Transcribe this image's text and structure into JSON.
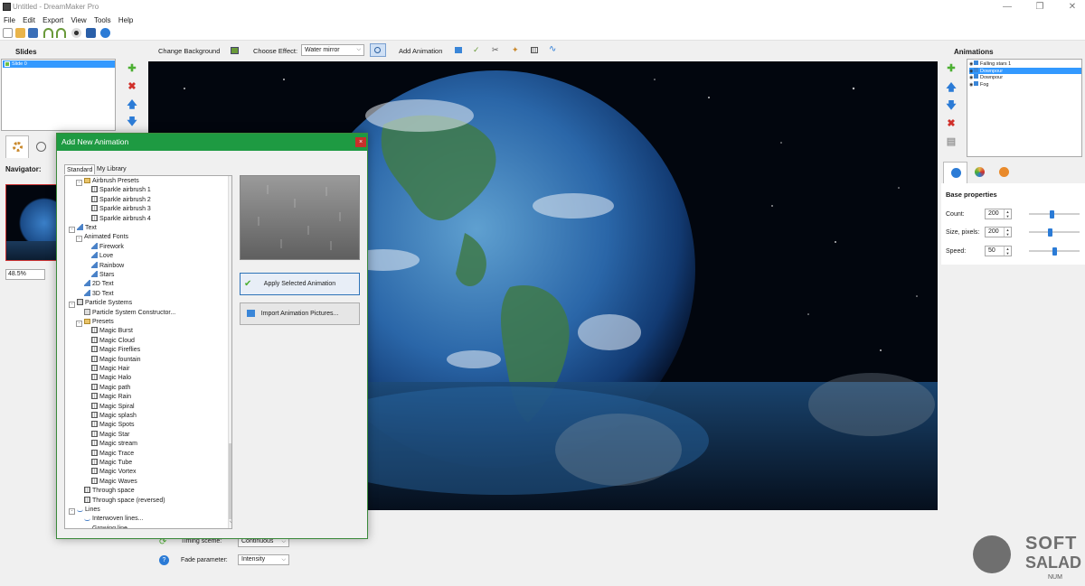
{
  "window": {
    "title": "Untitled - DreamMaker Pro",
    "controls": {
      "minimize": "—",
      "restore": "❐",
      "close": "✕"
    }
  },
  "menu": [
    "File",
    "Edit",
    "Export",
    "View",
    "Tools",
    "Help"
  ],
  "toolbar_icons": [
    "new-icon",
    "open-folder-icon",
    "save-icon",
    "magnet-icon",
    "magnet-icon",
    "eye-icon",
    "film-icon",
    "info-icon"
  ],
  "slides": {
    "title": "Slides",
    "items": [
      "Slide 0"
    ]
  },
  "navigator": {
    "label": "Navigator:",
    "zoom": "48.5%"
  },
  "main_toolbar": {
    "change_background": "Change Background",
    "choose_effect_label": "Choose Effect:",
    "effect_value": "Water mirror",
    "add_animation": "Add Animation"
  },
  "dialog": {
    "title": "Add New Animation",
    "close": "×",
    "tabs": [
      "Standard",
      "My Library"
    ],
    "tree": [
      {
        "label": "Airbrush Presets",
        "level": 1,
        "icon": "folder",
        "toggle": "-"
      },
      {
        "label": "Sparkle airbrush 1",
        "level": 2,
        "icon": "grid"
      },
      {
        "label": "Sparkle airbrush 2",
        "level": 2,
        "icon": "grid"
      },
      {
        "label": "Sparkle airbrush 3",
        "level": 2,
        "icon": "grid"
      },
      {
        "label": "Sparkle airbrush 4",
        "level": 2,
        "icon": "grid"
      },
      {
        "label": "Text",
        "level": 0,
        "icon": "text",
        "toggle": "-"
      },
      {
        "label": "Animated Fonts",
        "level": 1,
        "icon": "none",
        "toggle": "-"
      },
      {
        "label": "Firework",
        "level": 2,
        "icon": "text"
      },
      {
        "label": "Love",
        "level": 2,
        "icon": "text"
      },
      {
        "label": "Rainbow",
        "level": 2,
        "icon": "text"
      },
      {
        "label": "Stars",
        "level": 2,
        "icon": "text"
      },
      {
        "label": "2D Text",
        "level": 1,
        "icon": "text"
      },
      {
        "label": "3D Text",
        "level": 1,
        "icon": "text"
      },
      {
        "label": "Particle Systems",
        "level": 0,
        "icon": "grid",
        "toggle": "-"
      },
      {
        "label": "Particle System Constructor...",
        "level": 1,
        "icon": "box"
      },
      {
        "label": "Presets",
        "level": 1,
        "icon": "folder",
        "toggle": "-"
      },
      {
        "label": "Magic Burst",
        "level": 2,
        "icon": "grid"
      },
      {
        "label": "Magic Cloud",
        "level": 2,
        "icon": "grid"
      },
      {
        "label": "Magic Fireflies",
        "level": 2,
        "icon": "grid"
      },
      {
        "label": "Magic fountain",
        "level": 2,
        "icon": "grid"
      },
      {
        "label": "Magic Hair",
        "level": 2,
        "icon": "grid"
      },
      {
        "label": "Magic Halo",
        "level": 2,
        "icon": "grid"
      },
      {
        "label": "Magic path",
        "level": 2,
        "icon": "grid"
      },
      {
        "label": "Magic Rain",
        "level": 2,
        "icon": "grid"
      },
      {
        "label": "Magic Spiral",
        "level": 2,
        "icon": "grid"
      },
      {
        "label": "Magic splash",
        "level": 2,
        "icon": "grid"
      },
      {
        "label": "Magic Spots",
        "level": 2,
        "icon": "grid"
      },
      {
        "label": "Magic Star",
        "level": 2,
        "icon": "grid"
      },
      {
        "label": "Magic stream",
        "level": 2,
        "icon": "grid"
      },
      {
        "label": "Magic Trace",
        "level": 2,
        "icon": "grid"
      },
      {
        "label": "Magic Tube",
        "level": 2,
        "icon": "grid"
      },
      {
        "label": "Magic Vortex",
        "level": 2,
        "icon": "grid"
      },
      {
        "label": "Magic Waves",
        "level": 2,
        "icon": "grid"
      },
      {
        "label": "Through space",
        "level": 1,
        "icon": "grid"
      },
      {
        "label": "Through space (reversed)",
        "level": 1,
        "icon": "grid"
      },
      {
        "label": "Lines",
        "level": 0,
        "icon": "wave",
        "toggle": "-"
      },
      {
        "label": "Interwoven lines...",
        "level": 1,
        "icon": "wave"
      },
      {
        "label": "Growing line...",
        "level": 1,
        "icon": "wave"
      }
    ],
    "apply_button": "Apply Selected Animation",
    "import_button": "Import Animation Pictures..."
  },
  "timing": {
    "timing_label": "Timing sceme:",
    "timing_value": "Continuous",
    "fade_label": "Fade parameter:",
    "fade_value": "Intensity"
  },
  "animations": {
    "title": "Animations",
    "items": [
      {
        "label": "Falling stars 1",
        "selected": false
      },
      {
        "label": "Downpour",
        "selected": true
      },
      {
        "label": "Downpour",
        "selected": false
      },
      {
        "label": "Fog",
        "selected": false
      }
    ]
  },
  "properties": {
    "title": "Base properties",
    "count_label": "Count:",
    "count": "200",
    "count_level": 0.45,
    "size_label": "Size, pixels:",
    "size": "200",
    "size_level": 0.42,
    "speed_label": "Speed:",
    "speed": "50",
    "speed_level": 0.5
  },
  "watermark": {
    "line1": "SOFT",
    "line2": "SALAD",
    "line3": "NUM"
  },
  "colors": {
    "accent_green": "#1e9a42",
    "selection_blue": "#3399ff",
    "icon_blue": "#2b7bd6"
  }
}
